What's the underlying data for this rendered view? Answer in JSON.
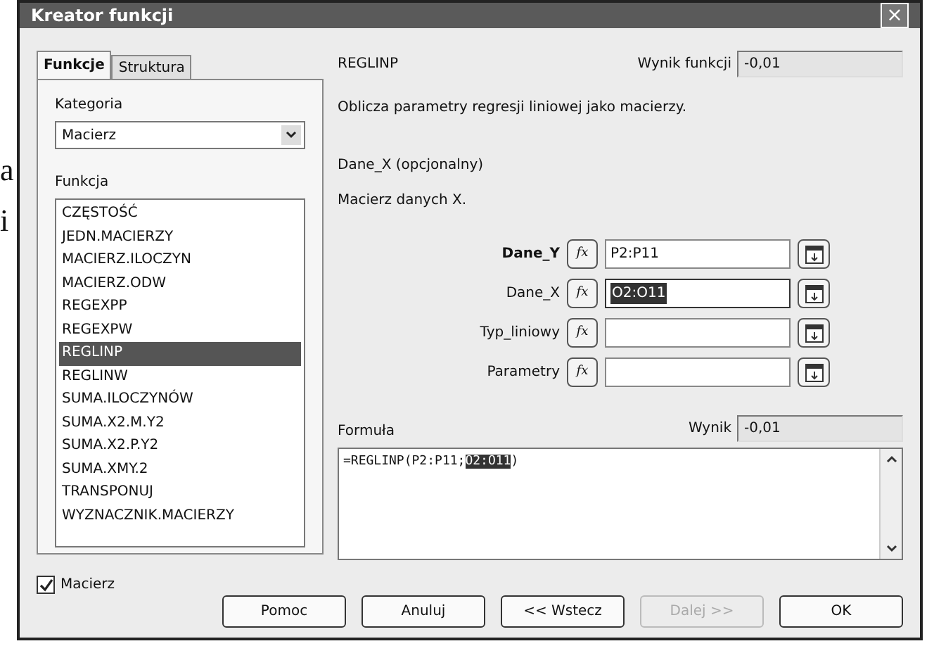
{
  "background_text": [
    "a",
    "i"
  ],
  "window": {
    "title": "Kreator funkcji",
    "close": "×"
  },
  "tabs": [
    {
      "label": "Funkcje",
      "selected": true
    },
    {
      "label": "Struktura",
      "selected": false
    }
  ],
  "category": {
    "label": "Kategoria",
    "value": "Macierz"
  },
  "functions": {
    "label": "Funkcja",
    "items": [
      {
        "label": "CZĘSTOŚĆ",
        "selected": false
      },
      {
        "label": "JEDN.MACIERZY",
        "selected": false
      },
      {
        "label": "MACIERZ.ILOCZYN",
        "selected": false
      },
      {
        "label": "MACIERZ.ODW",
        "selected": false
      },
      {
        "label": "REGEXPP",
        "selected": false
      },
      {
        "label": "REGEXPW",
        "selected": false
      },
      {
        "label": "REGLINP",
        "selected": true
      },
      {
        "label": "REGLINW",
        "selected": false
      },
      {
        "label": "SUMA.ILOCZYNÓW",
        "selected": false
      },
      {
        "label": "SUMA.X2.M.Y2",
        "selected": false
      },
      {
        "label": "SUMA.X2.P.Y2",
        "selected": false
      },
      {
        "label": "SUMA.XMY.2",
        "selected": false
      },
      {
        "label": "TRANSPONUJ",
        "selected": false
      },
      {
        "label": "WYZNACZNIK.MACIERZY",
        "selected": false
      }
    ]
  },
  "array_option": {
    "label": "Macierz",
    "checked": true
  },
  "function_name": "REGLINP",
  "function_result": {
    "label": "Wynik funkcji",
    "value": "-0,01"
  },
  "description": "Oblicza parametry regresji liniowej jako macierzy.",
  "argument_title": "Dane_X (opcjonalny)",
  "argument_description": "Macierz danych X.",
  "arguments": [
    {
      "label": "Dane_Y",
      "fx": "fx",
      "value": "P2:P11",
      "required": true,
      "selected": false
    },
    {
      "label": "Dane_X",
      "fx": "fx",
      "value": "O2:O11",
      "required": false,
      "selected": true
    },
    {
      "label": "Typ_liniowy",
      "fx": "fx",
      "required": false,
      "selected": false
    },
    {
      "label": "Parametry",
      "fx": "fx",
      "required": false,
      "selected": false
    }
  ],
  "result": {
    "label": "Wynik",
    "value": "-0,01"
  },
  "formula": {
    "label": "Formuła",
    "parts": [
      {
        "text": "=REGLINP(P2:P11;",
        "selected": false
      },
      {
        "text": "O2:O11",
        "selected": true
      },
      {
        "text": ")",
        "selected": false
      }
    ]
  },
  "buttons": [
    {
      "label": "Pomoc",
      "disabled": false
    },
    {
      "label": "Anuluj",
      "disabled": false
    },
    {
      "label": "<< Wstecz",
      "disabled": false
    },
    {
      "label": "Dalej >>",
      "disabled": true
    },
    {
      "label": "OK",
      "disabled": false
    }
  ]
}
